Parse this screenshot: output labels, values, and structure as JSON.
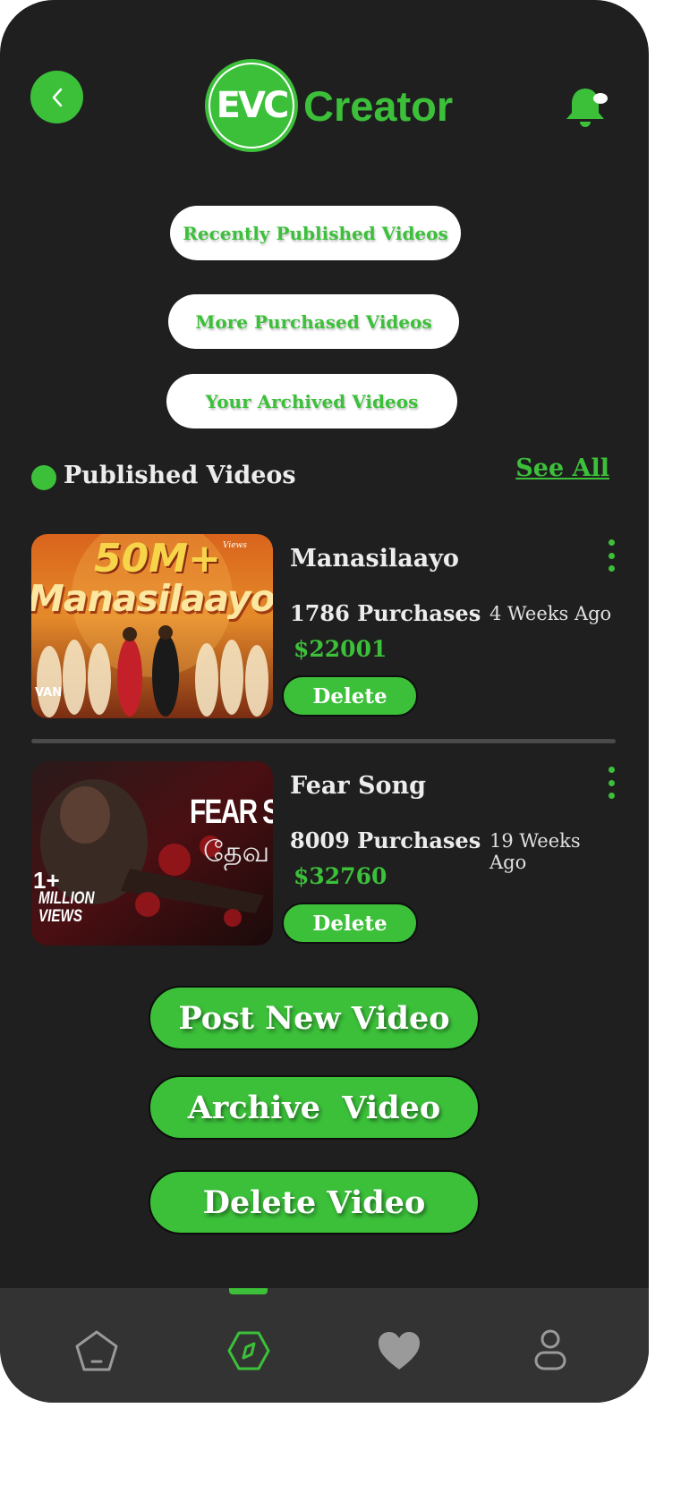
{
  "header": {
    "logo_mark": "EVC",
    "logo_text": "Creator"
  },
  "filters": [
    {
      "label": "Recently Published Videos"
    },
    {
      "label": "More Purchased Videos"
    },
    {
      "label": "Your Archived Videos"
    }
  ],
  "section": {
    "title": "Published Videos",
    "see_all": "See All"
  },
  "videos": [
    {
      "title": "Manasilaayo",
      "purchases": "1786 Purchases",
      "time_ago": "4 Weeks Ago",
      "price": "$22001",
      "delete_label": "Delete",
      "thumb_text": "50M+",
      "thumb_text2": "Manasilaayo",
      "thumb_text3": "Views",
      "thumb_text4": "VAN"
    },
    {
      "title": "Fear Song",
      "purchases": "8009 Purchases",
      "time_ago": "19 Weeks Ago",
      "price": "$32760",
      "delete_label": "Delete",
      "thumb_text": "FEAR SO",
      "thumb_text2": "1+",
      "thumb_text3": "MILLION",
      "thumb_text4": "VIEWS",
      "thumb_text5": "தேவ"
    }
  ],
  "actions": {
    "post": "Post New Video",
    "archive": "Archive  Video",
    "delete": "Delete Video"
  },
  "nav": {
    "items": [
      "home-icon",
      "explore-icon",
      "heart-icon",
      "profile-icon"
    ],
    "active": "explore-icon"
  },
  "colors": {
    "accent": "#3cc03a",
    "background": "#1f1f1f",
    "navbar": "#333333"
  }
}
